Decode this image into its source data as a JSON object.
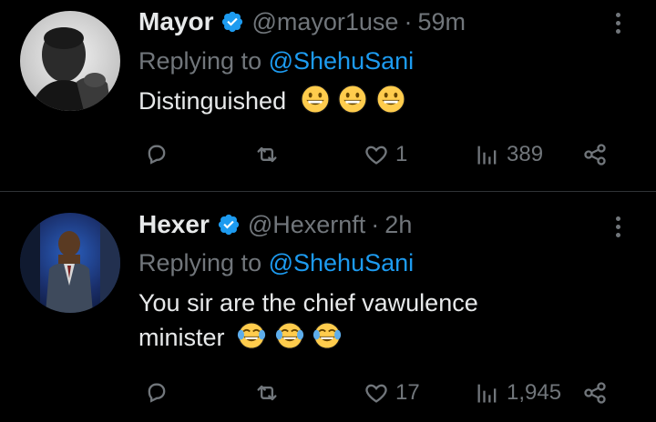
{
  "tweets": [
    {
      "name": "Mayor",
      "handle": "@mayor1use",
      "separator": "·",
      "time": "59m",
      "replying_prefix": "Replying to",
      "replying_to": "@ShehuSani",
      "text": "Distinguished",
      "emojis": [
        "grinning-face",
        "grinning-face",
        "grinning-face"
      ],
      "stats": {
        "replies": "",
        "retweets": "",
        "likes": "1",
        "views": "389"
      }
    },
    {
      "name": "Hexer",
      "handle": "@Hexernft",
      "separator": "·",
      "time": "2h",
      "replying_prefix": "Replying to",
      "replying_to": "@ShehuSani",
      "text_line1": "You sir are the chief vawulence",
      "text_line2": "minister",
      "emojis": [
        "face-with-tears-of-joy",
        "face-with-tears-of-joy",
        "face-with-tears-of-joy"
      ],
      "stats": {
        "replies": "",
        "retweets": "",
        "likes": "17",
        "views": "1,945"
      }
    }
  ],
  "colors": {
    "background": "#000000",
    "text": "#e7e9ea",
    "muted": "#71767b",
    "link": "#1d9bf0",
    "verified": "#1d9bf0",
    "divider": "#2f3336"
  }
}
